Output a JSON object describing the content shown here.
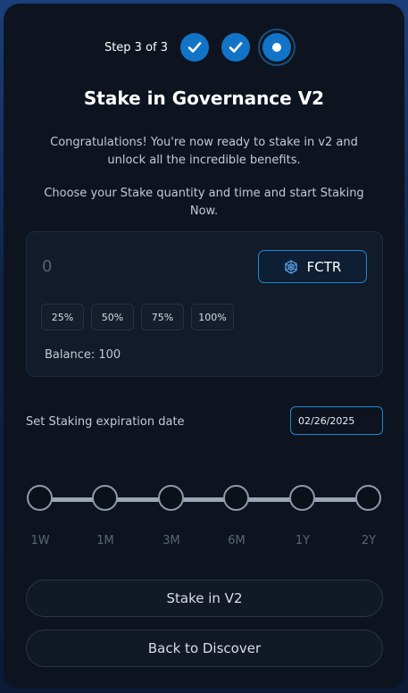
{
  "stepper": {
    "label": "Step 3 of 3",
    "steps": [
      "complete",
      "complete",
      "current"
    ]
  },
  "header": {
    "title": "Stake in Governance V2"
  },
  "intro": {
    "line1": "Congratulations! You're now ready to stake in v2 and unlock all the incredible benefits.",
    "line2": "Choose your Stake quantity and time and start Staking Now."
  },
  "stake": {
    "amount_value": "0",
    "token_label": "FCTR",
    "token_icon": "fctr-logo-icon",
    "percent_buttons": [
      "25%",
      "50%",
      "75%",
      "100%"
    ],
    "balance_text": "Balance: 100"
  },
  "expiration": {
    "label": "Set Staking expiration date",
    "date_value": "02/26/2025"
  },
  "duration": {
    "options": [
      "1W",
      "1M",
      "3M",
      "6M",
      "1Y",
      "2Y"
    ]
  },
  "actions": {
    "stake_label": "Stake in V2",
    "back_label": "Back to Discover"
  },
  "colors": {
    "accent": "#1174c7",
    "card_bg": "#0d1420",
    "border_accent": "#1f87d2"
  }
}
